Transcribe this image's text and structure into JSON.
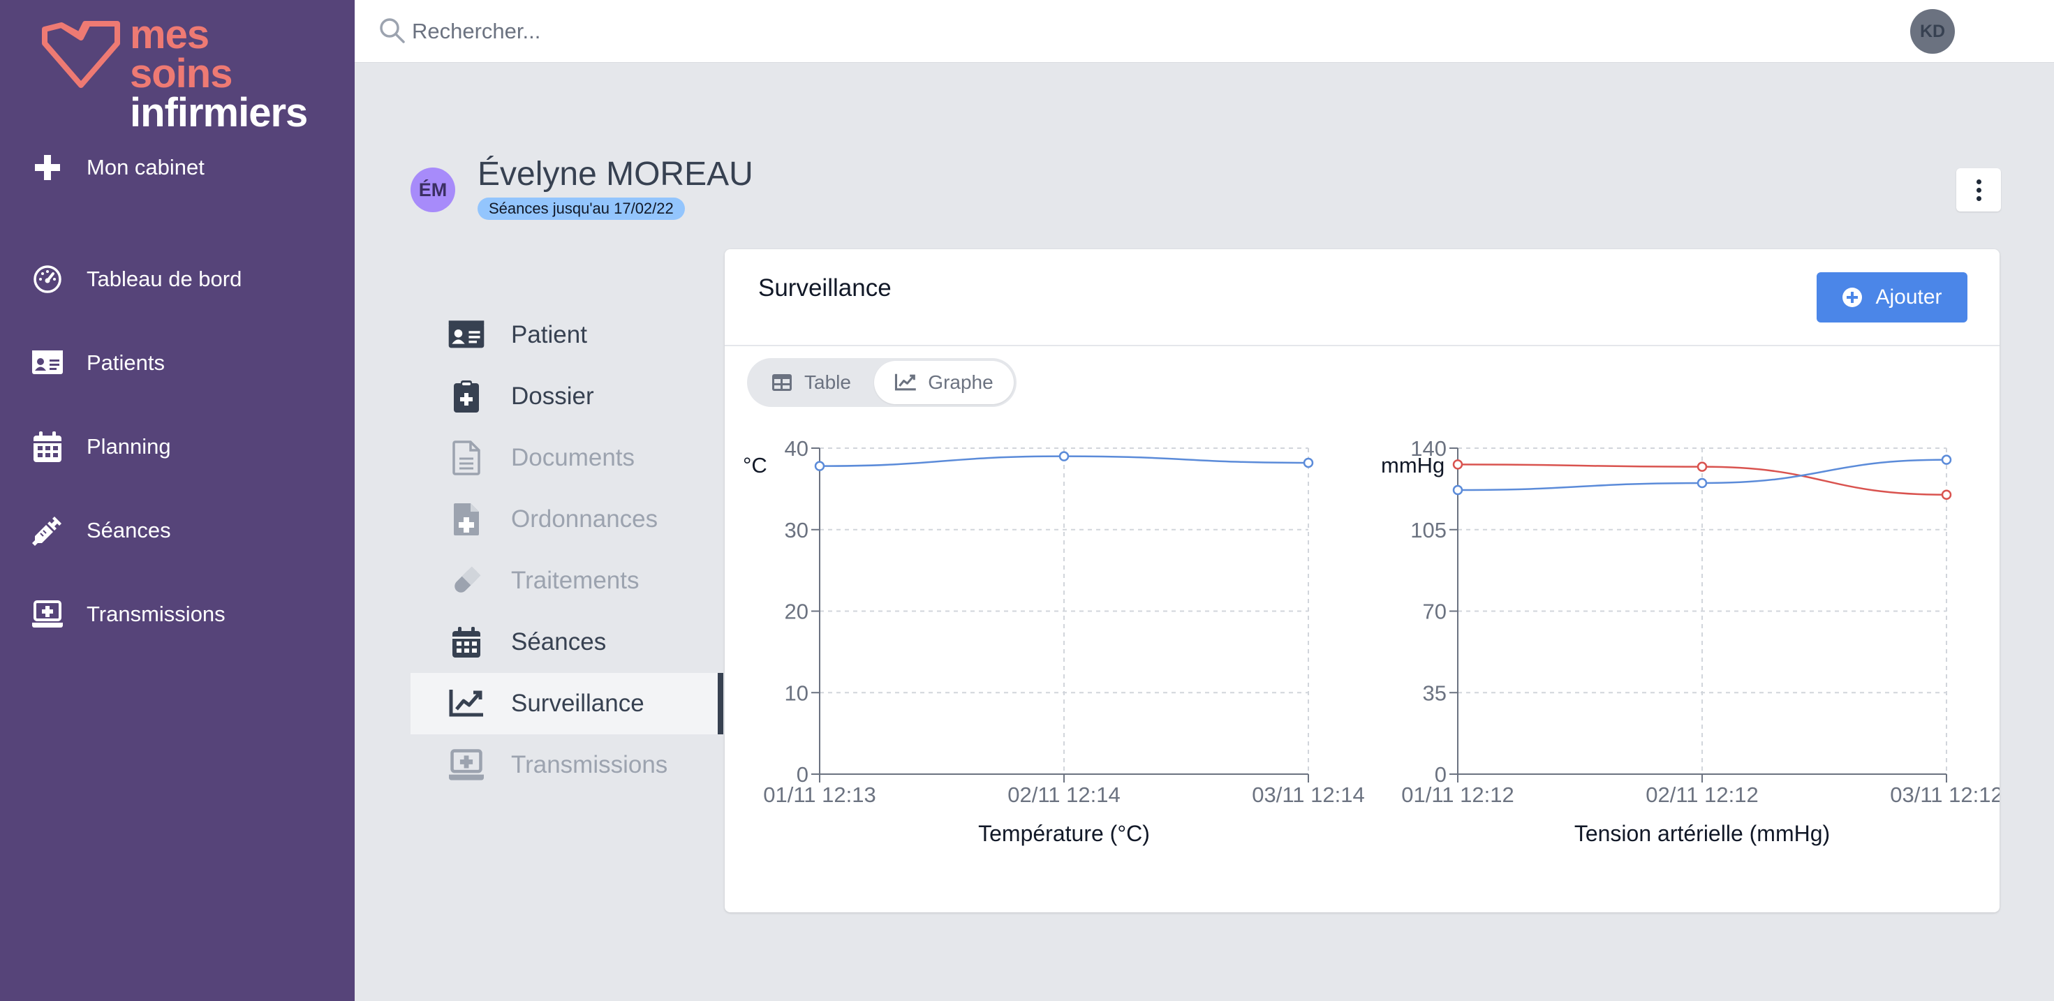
{
  "app": {
    "logo_line1": "mes soins",
    "logo_line2": "infirmiers"
  },
  "sidebar": {
    "items": [
      {
        "label": "Mon cabinet",
        "icon": "plus-icon"
      },
      {
        "label": "Tableau de bord",
        "icon": "gauge-icon"
      },
      {
        "label": "Patients",
        "icon": "id-card-icon"
      },
      {
        "label": "Planning",
        "icon": "calendar-icon"
      },
      {
        "label": "Séances",
        "icon": "syringe-icon"
      },
      {
        "label": "Transmissions",
        "icon": "laptop-medical-icon"
      }
    ]
  },
  "topbar": {
    "search_placeholder": "Rechercher...",
    "user_initials": "KD"
  },
  "patient": {
    "initials": "ÉM",
    "name": "Évelyne MOREAU",
    "badge": "Séances jusqu'au 17/02/22"
  },
  "patient_nav": {
    "items": [
      {
        "label": "Patient",
        "state": "enabled",
        "icon": "id-card-icon"
      },
      {
        "label": "Dossier",
        "state": "enabled",
        "icon": "clipboard-medical-icon"
      },
      {
        "label": "Documents",
        "state": "disabled",
        "icon": "file-icon"
      },
      {
        "label": "Ordonnances",
        "state": "disabled",
        "icon": "file-medical-icon"
      },
      {
        "label": "Traitements",
        "state": "disabled",
        "icon": "capsule-icon"
      },
      {
        "label": "Séances",
        "state": "enabled",
        "icon": "calendar-icon"
      },
      {
        "label": "Surveillance",
        "state": "active",
        "icon": "chart-line-icon"
      },
      {
        "label": "Transmissions",
        "state": "disabled",
        "icon": "laptop-medical-icon"
      }
    ]
  },
  "card": {
    "title": "Surveillance",
    "add_label": "Ajouter",
    "toggle_table": "Table",
    "toggle_graph": "Graphe"
  },
  "colors": {
    "sidebar_bg": "#564479",
    "accent_blue": "#4b86e8",
    "logo_coral": "#ee7a73",
    "series_blue": "#5b8bd9",
    "series_red": "#d9534f"
  },
  "chart_data": [
    {
      "type": "line",
      "unit_label": "°C",
      "xlabel": "Température (°C)",
      "x": [
        "01/11 12:13",
        "02/11 12:14",
        "03/11 12:14"
      ],
      "ylim": [
        0,
        40
      ],
      "yticks": [
        0,
        10,
        20,
        30,
        40
      ],
      "grid": true,
      "series": [
        {
          "values": [
            37.8,
            39.0,
            38.2
          ],
          "color": "#5b8bd9"
        }
      ]
    },
    {
      "type": "line",
      "unit_label": "mmHg",
      "xlabel": "Tension artérielle (mmHg)",
      "x": [
        "01/11 12:12",
        "02/11 12:12",
        "03/11 12:12"
      ],
      "ylim": [
        0,
        140
      ],
      "yticks": [
        0,
        35,
        70,
        105,
        140
      ],
      "grid": true,
      "series": [
        {
          "values": [
            133,
            132,
            120
          ],
          "color": "#d9534f"
        },
        {
          "values": [
            122,
            125,
            135
          ],
          "color": "#5b8bd9"
        }
      ]
    }
  ]
}
